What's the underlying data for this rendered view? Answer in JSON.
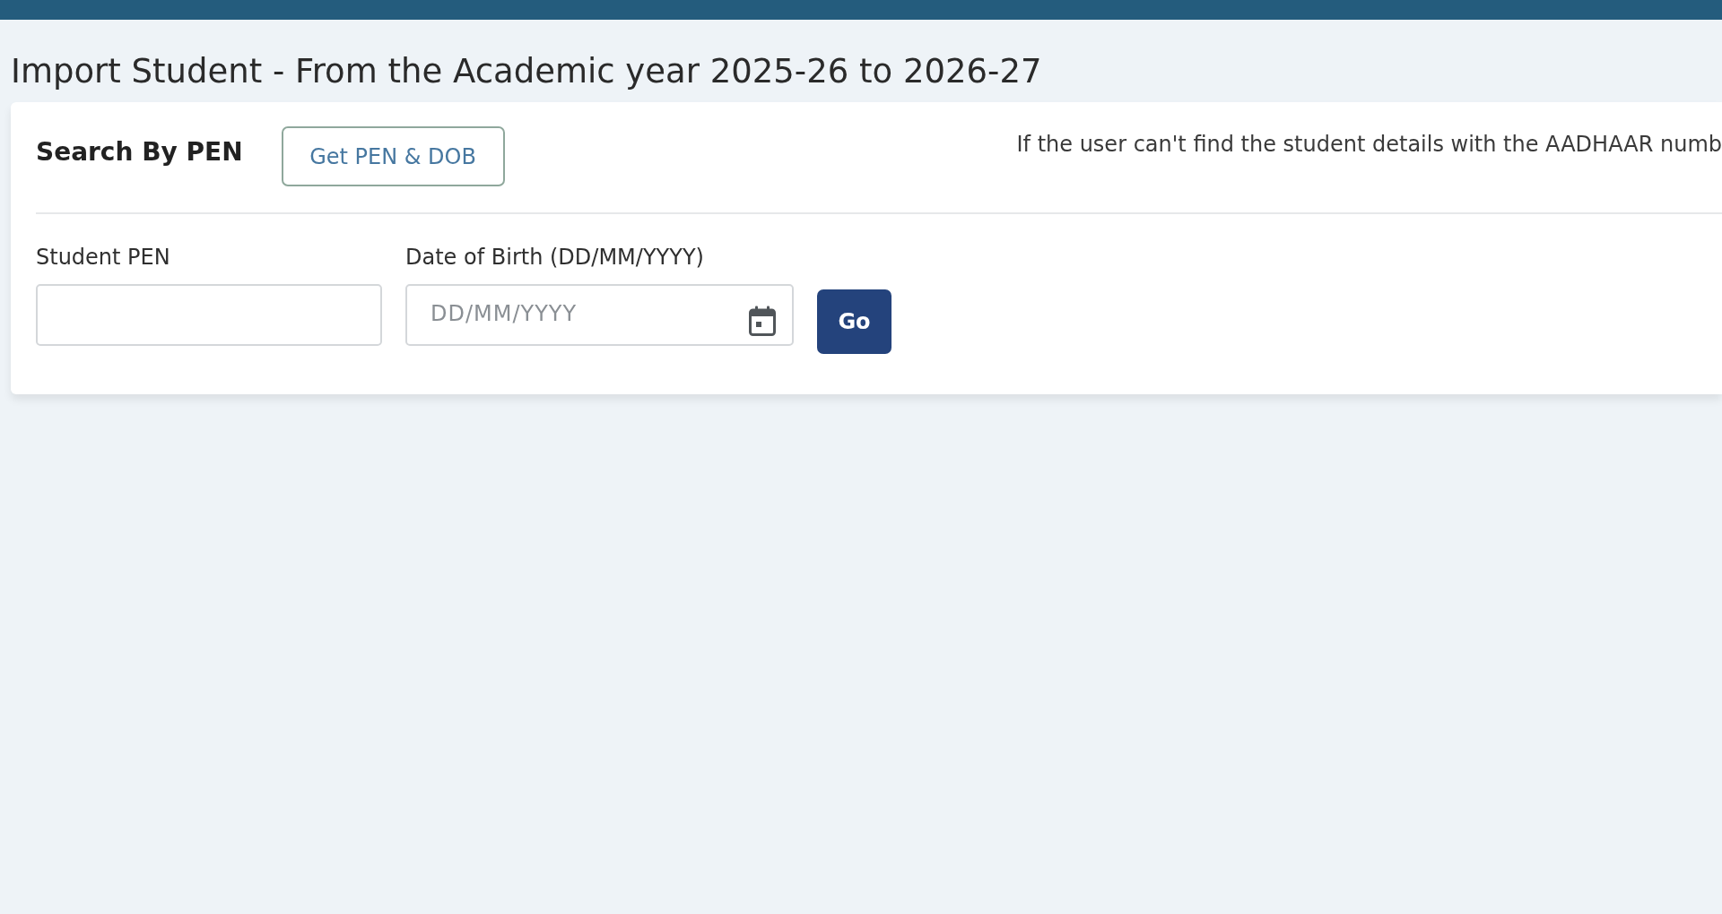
{
  "page_title": "Import Student - From the Academic year 2025-26 to 2026-27",
  "search_panel": {
    "title": "Search By PEN",
    "lookup_button": "Get PEN & DOB",
    "notice": "If the user can't find the student details with the AADHAAR numb",
    "fields": [
      {
        "kind": "text",
        "label": "Student PEN"
      },
      {
        "kind": "date",
        "label": "Date of Birth (DD/MM/YYYY)",
        "placeholder": "DD/MM/YYYY"
      }
    ],
    "submit_button": "Go"
  }
}
